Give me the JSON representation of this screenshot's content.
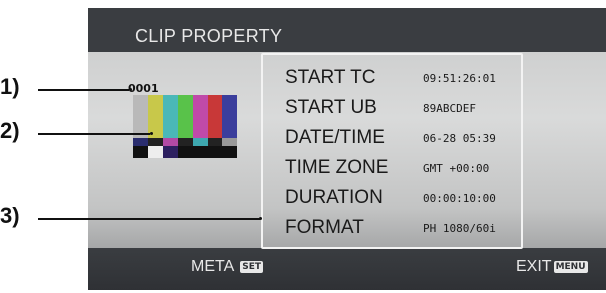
{
  "screen": {
    "title": "CLIP PROPERTY",
    "clip_number": "0001",
    "thumbnail_icon": "color-bars-thumbnail"
  },
  "properties": [
    {
      "label": "START TC",
      "value": "09:51:26:01"
    },
    {
      "label": "START UB",
      "value": "89ABCDEF"
    },
    {
      "label": "DATE/TIME",
      "value": "06-28 05:39"
    },
    {
      "label": "TIME ZONE",
      "value": "GMT +00:00"
    },
    {
      "label": "DURATION",
      "value": "00:00:10:00"
    },
    {
      "label": "FORMAT",
      "value": "PH 1080/60i"
    }
  ],
  "bottom_bar": {
    "meta_label": "META",
    "meta_key": "SET",
    "exit_label": "EXIT",
    "exit_key": "MENU"
  },
  "callouts": [
    "1)",
    "2)",
    "3)"
  ],
  "colors": {
    "screen_dark": "#3a3d41",
    "screen_light": "#d9dada",
    "panel_border": "#f3f3f3"
  }
}
